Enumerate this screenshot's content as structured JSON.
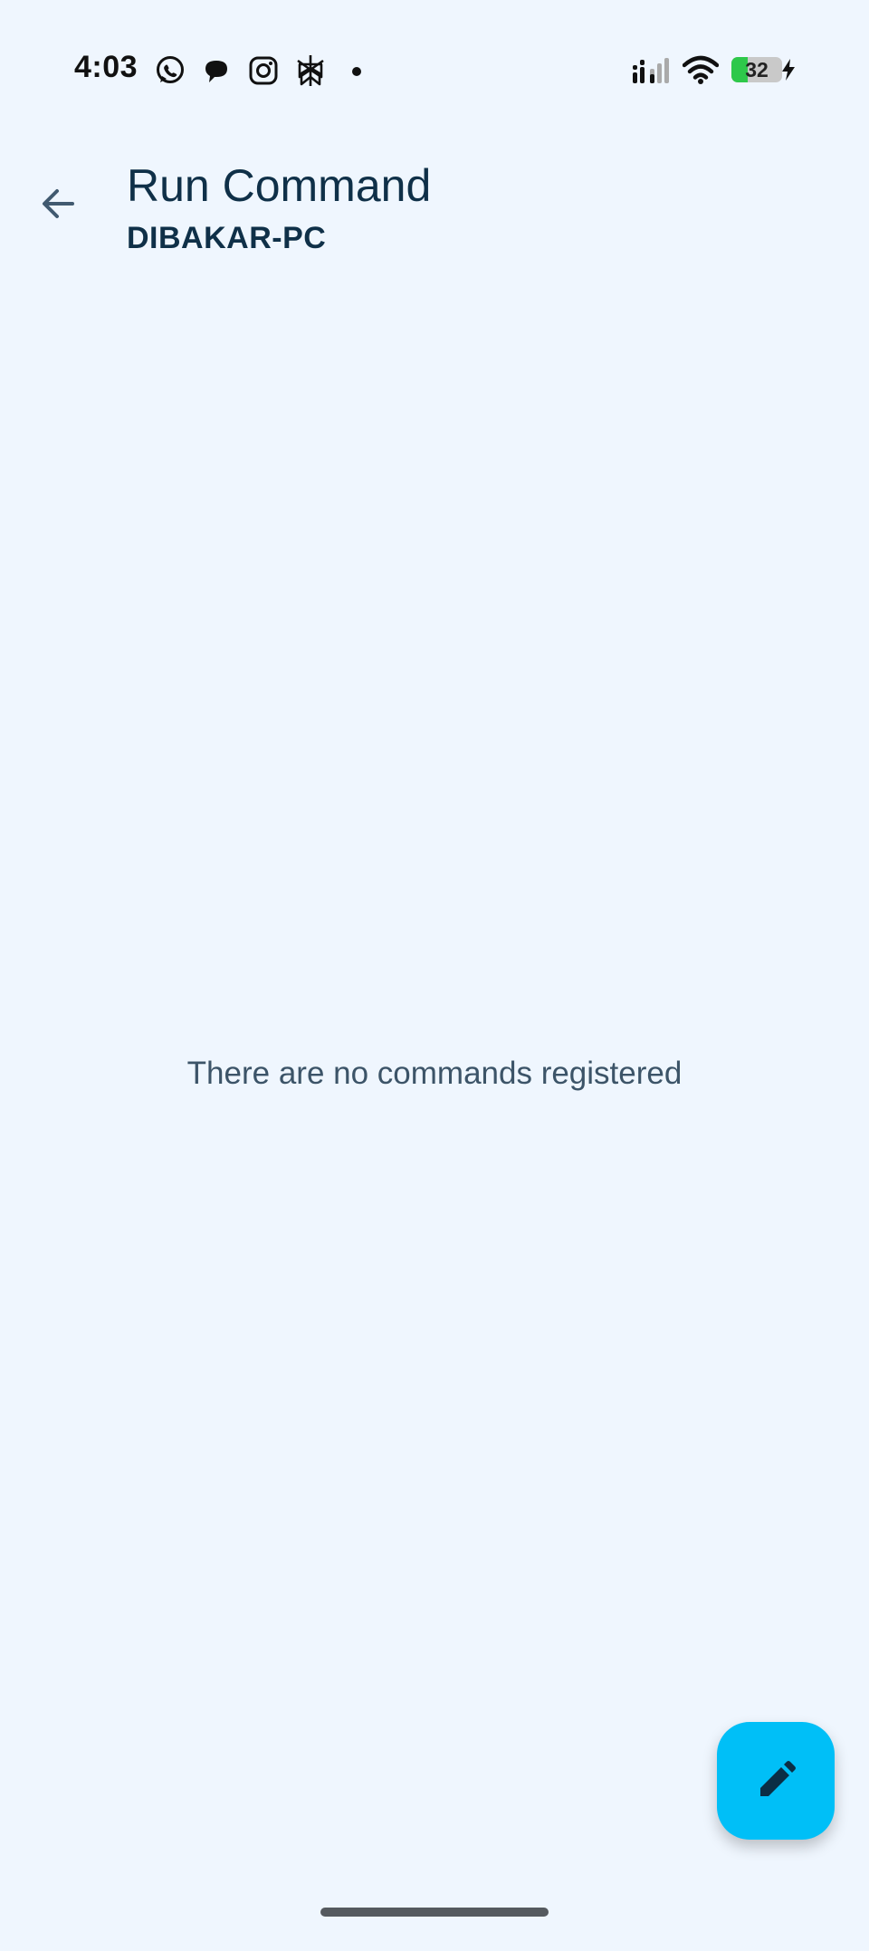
{
  "status_bar": {
    "time": "4:03",
    "notification_icons": [
      "whatsapp-icon",
      "chat-bubble-icon",
      "instagram-icon",
      "perplexity-icon",
      "more-notifications-dot-icon"
    ],
    "signal_icon": "signal-icon",
    "wifi_icon": "wifi-icon",
    "battery_level": "32",
    "battery_fraction": 0.32,
    "charging_icon": "bolt-icon",
    "battery_color": "#2ec84a"
  },
  "app_bar": {
    "back_icon": "arrow-back-icon",
    "title": "Run Command",
    "subtitle": "DIBAKAR-PC"
  },
  "main": {
    "empty_message": "There are no commands registered"
  },
  "fab": {
    "icon": "pencil-icon",
    "color": "#00bff7"
  }
}
